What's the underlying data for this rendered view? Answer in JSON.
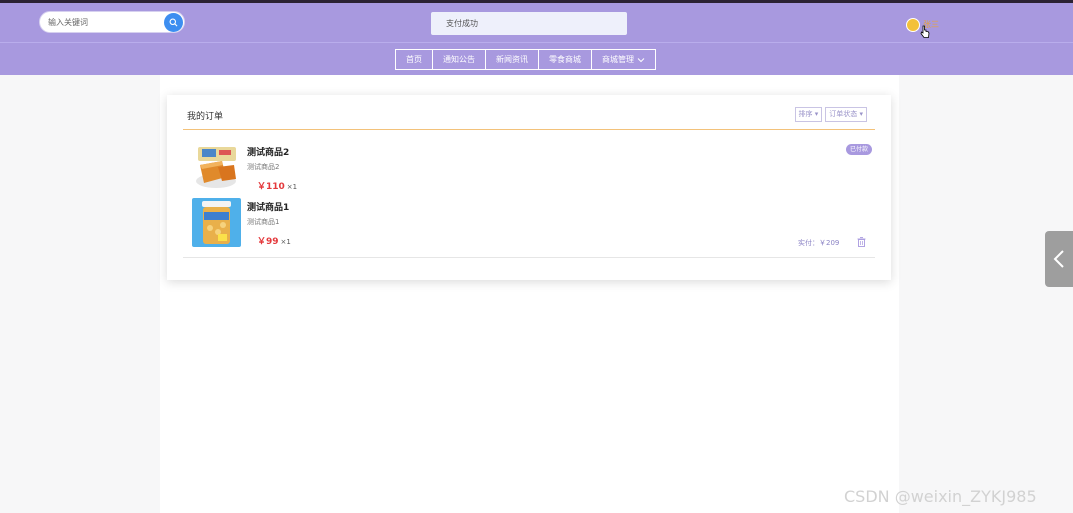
{
  "header": {
    "search": {
      "placeholder": "输入关键词"
    },
    "toast": "支付成功",
    "user": {
      "name": "张三"
    }
  },
  "nav": {
    "items": [
      {
        "label": "首页"
      },
      {
        "label": "通知公告"
      },
      {
        "label": "新闻资讯"
      },
      {
        "label": "零食商城"
      },
      {
        "label": "商城管理"
      }
    ]
  },
  "orders": {
    "title": "我的订单",
    "sort_label": "排序",
    "status_filter_label": "订单状态",
    "status_badge": "已付款",
    "pay_label": "实付：￥209",
    "items": [
      {
        "name": "测试商品2",
        "desc": "测试商品2",
        "price": "￥110",
        "qty": "×1"
      },
      {
        "name": "测试商品1",
        "desc": "测试商品1",
        "price": "￥99",
        "qty": "×1"
      }
    ]
  },
  "watermark": "CSDN @weixin_ZYKJ985",
  "colors": {
    "header_bg": "#a899df",
    "price": "#e4393c",
    "search_button": "#3d8ef0",
    "accent_line": "#f3c27a"
  },
  "icons": [
    "search-icon",
    "avatar-icon",
    "pointer-cursor-icon",
    "chevron-down-icon",
    "delete-icon",
    "chevron-left-icon"
  ]
}
